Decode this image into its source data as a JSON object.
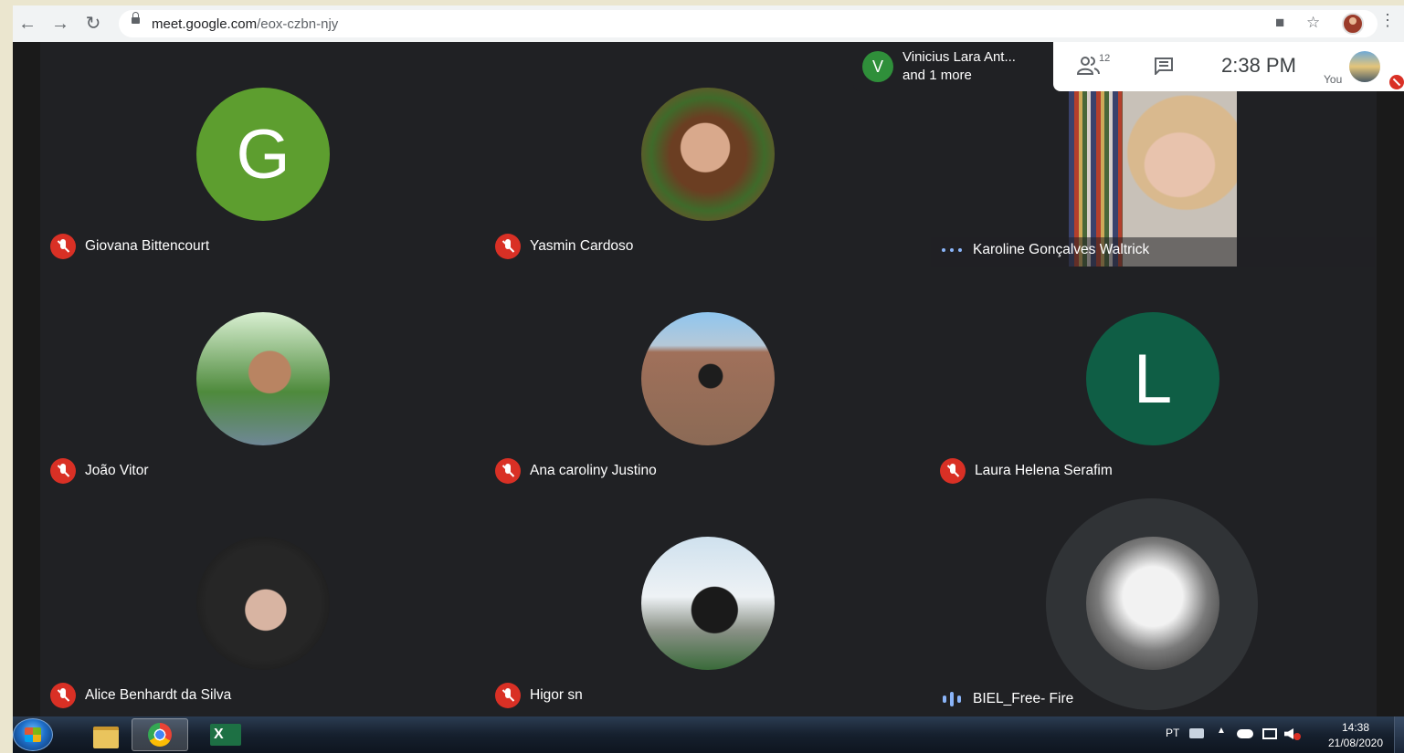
{
  "browser": {
    "url_host": "meet.google.com",
    "url_path": "/eox-czbn-njy",
    "icons": [
      "back-icon",
      "forward-icon",
      "reload-icon",
      "lock-icon",
      "camera-icon",
      "star-icon",
      "profile-avatar",
      "menu-icon"
    ]
  },
  "meet": {
    "presenter": {
      "initial": "V",
      "line1": "Vinicius Lara Ant...",
      "line2": "and 1 more",
      "color": "#2f8f3a"
    },
    "panel": {
      "participants_count": "12",
      "time": "2:38 PM",
      "you_label": "You"
    },
    "participants": [
      {
        "name": "Giovana Bittencourt",
        "avatar_letter": "G",
        "avatar_color": "#5d9e2f",
        "muted": true
      },
      {
        "name": "Yasmin Cardoso",
        "avatar_letter": "",
        "avatar_color": "",
        "muted": true
      },
      {
        "name": "Karoline Gonçalves Waltrick",
        "state": "video",
        "muted": false
      },
      {
        "name": "João Vitor",
        "avatar_letter": "",
        "avatar_color": "",
        "muted": true
      },
      {
        "name": "Ana caroliny Justino",
        "avatar_letter": "",
        "avatar_color": "",
        "muted": true
      },
      {
        "name": "Laura Helena Serafim",
        "avatar_letter": "L",
        "avatar_color": "#0f5e45",
        "muted": true
      },
      {
        "name": "Alice Benhardt da Silva",
        "avatar_letter": "",
        "avatar_color": "",
        "muted": true
      },
      {
        "name": "Higor sn",
        "avatar_letter": "",
        "avatar_color": "",
        "muted": true
      },
      {
        "name": "BIEL_Free- Fire",
        "state": "speaking",
        "muted": false
      }
    ],
    "colors": {
      "mute_red": "#d93025",
      "speaking_blue": "#8ab4f8",
      "background": "#202124"
    }
  },
  "taskbar": {
    "apps": [
      "windows-start",
      "file-explorer",
      "google-chrome",
      "microsoft-excel"
    ],
    "language": "PT",
    "time": "14:38",
    "date": "21/08/2020"
  }
}
